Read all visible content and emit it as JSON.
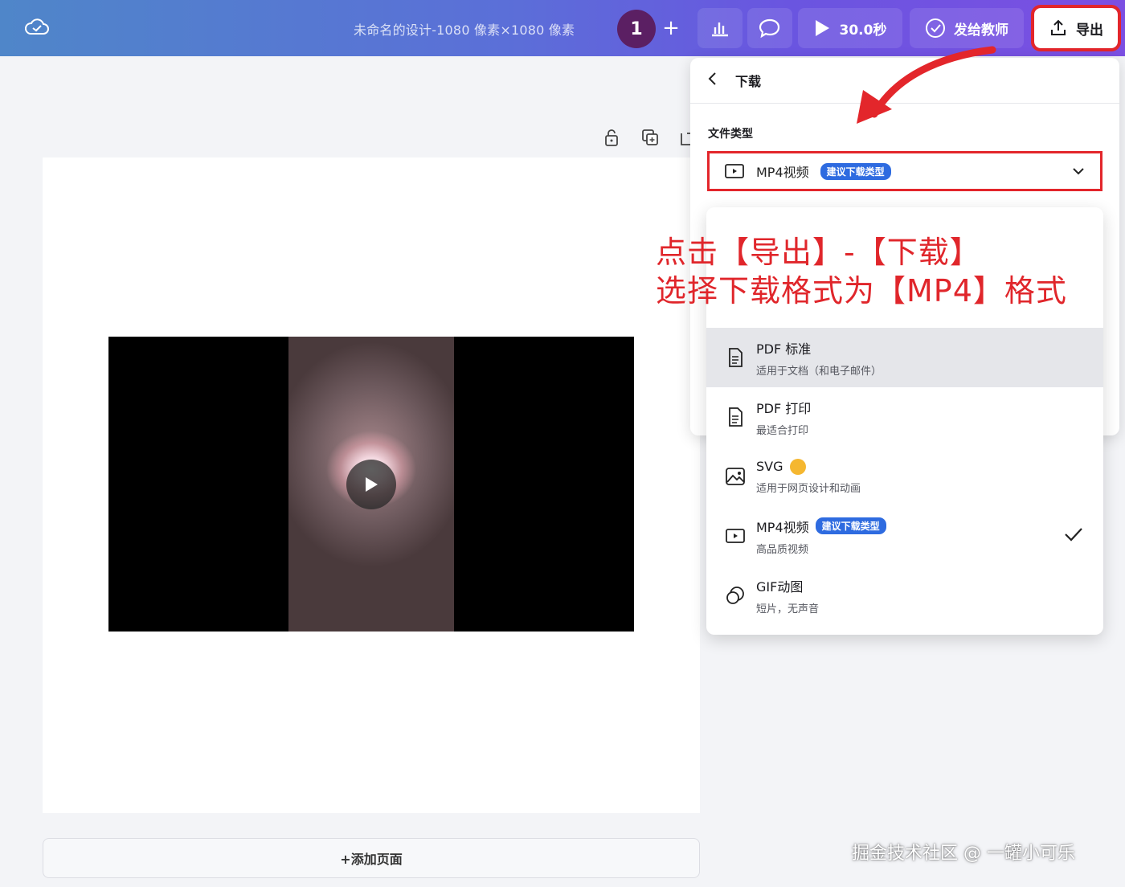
{
  "topbar": {
    "doc_title": "未命名的设计-1080 像素×1080 像素",
    "avatar_initial": "1",
    "plus": "+",
    "duration": "30.0秒",
    "present_label": "发给教师",
    "export_label": "导出"
  },
  "canvas": {
    "add_page": "+添加页面"
  },
  "panel": {
    "title": "下载",
    "file_type_label": "文件类型",
    "selected": {
      "label": "MP4视频",
      "badge": "建议下载类型"
    }
  },
  "dropdown": {
    "items": [
      {
        "name": "PDF 标准",
        "desc": "适用于文档（和电子邮件）",
        "icon": "pdf-icon"
      },
      {
        "name": "PDF 打印",
        "desc": "最适合打印",
        "icon": "pdf-print-icon"
      },
      {
        "name": "SVG",
        "desc": "适用于网页设计和动画",
        "icon": "image-icon"
      },
      {
        "name": "MP4视频",
        "desc": "高品质视频",
        "badge": "建议下载类型",
        "icon": "video-icon"
      },
      {
        "name": "GIF动图",
        "desc": "短片，无声音",
        "icon": "gif-icon"
      }
    ]
  },
  "annotation": {
    "line1": "点击【导出】-【下载】",
    "line2": "选择下载格式为【MP4】格式"
  },
  "watermark": "掘金技术社区 @ 一罐小可乐",
  "colors": {
    "accent_red": "#e3262b",
    "badge_blue": "#2e6be0",
    "avatar": "#5b1f63"
  }
}
